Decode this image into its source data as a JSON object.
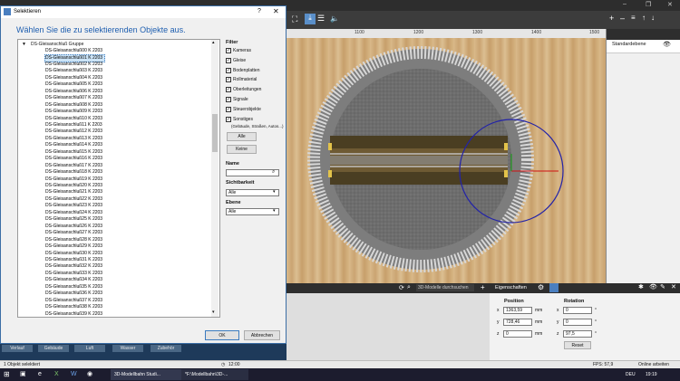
{
  "app": {
    "title": "3D-Modellbahn Studio - Modellbahn\\3D-MBS",
    "search_placeholder": "3D-Modelle durchsuchen"
  },
  "ruler": {
    "marks": [
      "1100",
      "1200",
      "1300",
      "1400",
      "1500"
    ]
  },
  "right_panel": {
    "layer": "Standardebene"
  },
  "properties": {
    "title": "Eigenschaften",
    "position_label": "Position",
    "rotation_label": "Rotation",
    "pos": [
      {
        "axis": "x",
        "value": "1363,59",
        "unit": "mm"
      },
      {
        "axis": "y",
        "value": "728,46",
        "unit": "mm"
      },
      {
        "axis": "z",
        "value": "0",
        "unit": "mm"
      }
    ],
    "rot": [
      {
        "axis": "x",
        "value": "0",
        "unit": "°"
      },
      {
        "axis": "y",
        "value": "0",
        "unit": "°"
      },
      {
        "axis": "z",
        "value": "97,5",
        "unit": "°"
      }
    ],
    "reset": "Reset"
  },
  "tabs": [
    "Verlauf",
    "Gebäude",
    "Luft",
    "Wasser",
    "Zubehör"
  ],
  "status": {
    "left": "1 Objekt selektiert",
    "time": "12:00",
    "fps": "FPS: 57,9",
    "mode": "Online arbeiten"
  },
  "taskbar": {
    "items": [
      "3D-Modellbahn Studi...",
      "*F:\\Modellbahn\\3D-..."
    ],
    "lang": "DEU",
    "clock": "19:19"
  },
  "dialog": {
    "title": "Selektieren",
    "heading": "Wählen Sie die zu selektierenden Objekte aus.",
    "group": "DS-Gleisanschluß Gruppe",
    "items": [
      "DS-Gleisanschluß00 K 2203",
      "DS-Gleisanschluß01 K 2203",
      "DS-Gleisanschluß02 K 2203",
      "DS-Gleisanschluß03 K 2203",
      "DS-Gleisanschluß04 K 2203",
      "DS-Gleisanschluß05 K 2203",
      "DS-Gleisanschluß06 K 2203",
      "DS-Gleisanschluß07 K 2203",
      "DS-Gleisanschluß08 K 2203",
      "DS-Gleisanschluß09 K 2203",
      "DS-Gleisanschluß10 K 2203",
      "DS-Gleisanschluß11 K 2203",
      "DS-Gleisanschluß12 K 2203",
      "DS-Gleisanschluß13 K 2203",
      "DS-Gleisanschluß14 K 2203",
      "DS-Gleisanschluß15 K 2203",
      "DS-Gleisanschluß16 K 2203",
      "DS-Gleisanschluß17 K 2203",
      "DS-Gleisanschluß18 K 2203",
      "DS-Gleisanschluß19 K 2203",
      "DS-Gleisanschluß20 K 2203",
      "DS-Gleisanschluß21 K 2203",
      "DS-Gleisanschluß22 K 2203",
      "DS-Gleisanschluß23 K 2203",
      "DS-Gleisanschluß24 K 2203",
      "DS-Gleisanschluß25 K 2203",
      "DS-Gleisanschluß26 K 2203",
      "DS-Gleisanschluß27 K 2203",
      "DS-Gleisanschluß28 K 2203",
      "DS-Gleisanschluß29 K 2203",
      "DS-Gleisanschluß30 K 2203",
      "DS-Gleisanschluß31 K 2203",
      "DS-Gleisanschluß32 K 2203",
      "DS-Gleisanschluß33 K 2203",
      "DS-Gleisanschluß34 K 2203",
      "DS-Gleisanschluß35 K 2203",
      "DS-Gleisanschluß36 K 2203",
      "DS-Gleisanschluß37 K 2203",
      "DS-Gleisanschluß38 K 2203",
      "DS-Gleisanschluß39 K 2203"
    ],
    "selected_index": 1,
    "filter_label": "Filter",
    "filters": [
      {
        "label": "Kameras",
        "checked": true
      },
      {
        "label": "Gleise",
        "checked": true
      },
      {
        "label": "Bodenplatten",
        "checked": true
      },
      {
        "label": "Rollmaterial",
        "checked": true
      },
      {
        "label": "Oberleitungen",
        "checked": true
      },
      {
        "label": "Signale",
        "checked": true
      },
      {
        "label": "Steuerobjekte",
        "checked": true
      },
      {
        "label": "Sonstiges",
        "checked": true
      }
    ],
    "sonstiges_sub": "(Gebäude, Straßen, Autos...)",
    "all_button": "Alle",
    "none_button": "Keine",
    "name_label": "Name",
    "name_value": "",
    "visibility_label": "Sichtbarkeit",
    "visibility_value": "Alle",
    "layer_label": "Ebene",
    "layer_value": "Alle",
    "ok": "OK",
    "cancel": "Abbrechen"
  },
  "colors": {
    "accent": "#1f5fb0",
    "selection": "#cce4f7"
  }
}
